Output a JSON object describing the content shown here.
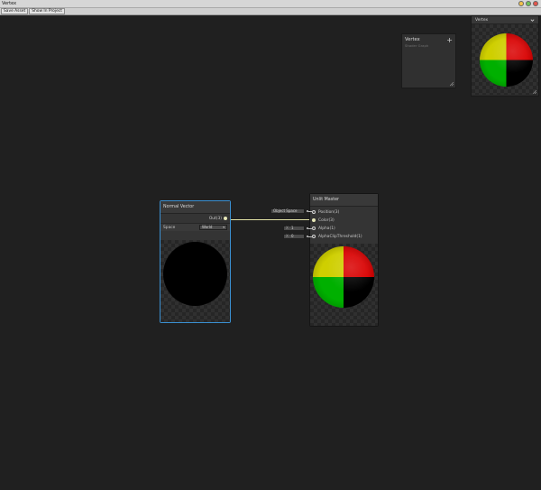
{
  "window": {
    "title": "Vertex"
  },
  "toolbar": {
    "save_asset": "Save Asset",
    "show_in_project": "Show In Project"
  },
  "blackboard": {
    "title": "Vertex",
    "subtitle": "Shader Graph",
    "add_symbol": "+"
  },
  "main_preview": {
    "title": "Vertex"
  },
  "normal_vector_node": {
    "title": "Normal Vector",
    "output_label": "Out(3)",
    "space_label": "Space",
    "space_value": "World",
    "dropdown_glyph": "▾"
  },
  "unlit_master_node": {
    "title": "Unlit Master",
    "ports": [
      {
        "label": "Position(3)"
      },
      {
        "label": "Color(3)"
      },
      {
        "label": "Alpha(1)"
      },
      {
        "label": "AlphaClipThreshold(1)"
      }
    ],
    "position_space": "Object Space",
    "alpha_field": {
      "axis": "X",
      "value": "1"
    },
    "alpha_clip_field": {
      "axis": "X",
      "value": "0"
    }
  },
  "colors": {
    "canvas_bg": "#202020",
    "node_bg": "#343434",
    "selection": "#3a8fd0",
    "edge": "#e2e2a6"
  }
}
